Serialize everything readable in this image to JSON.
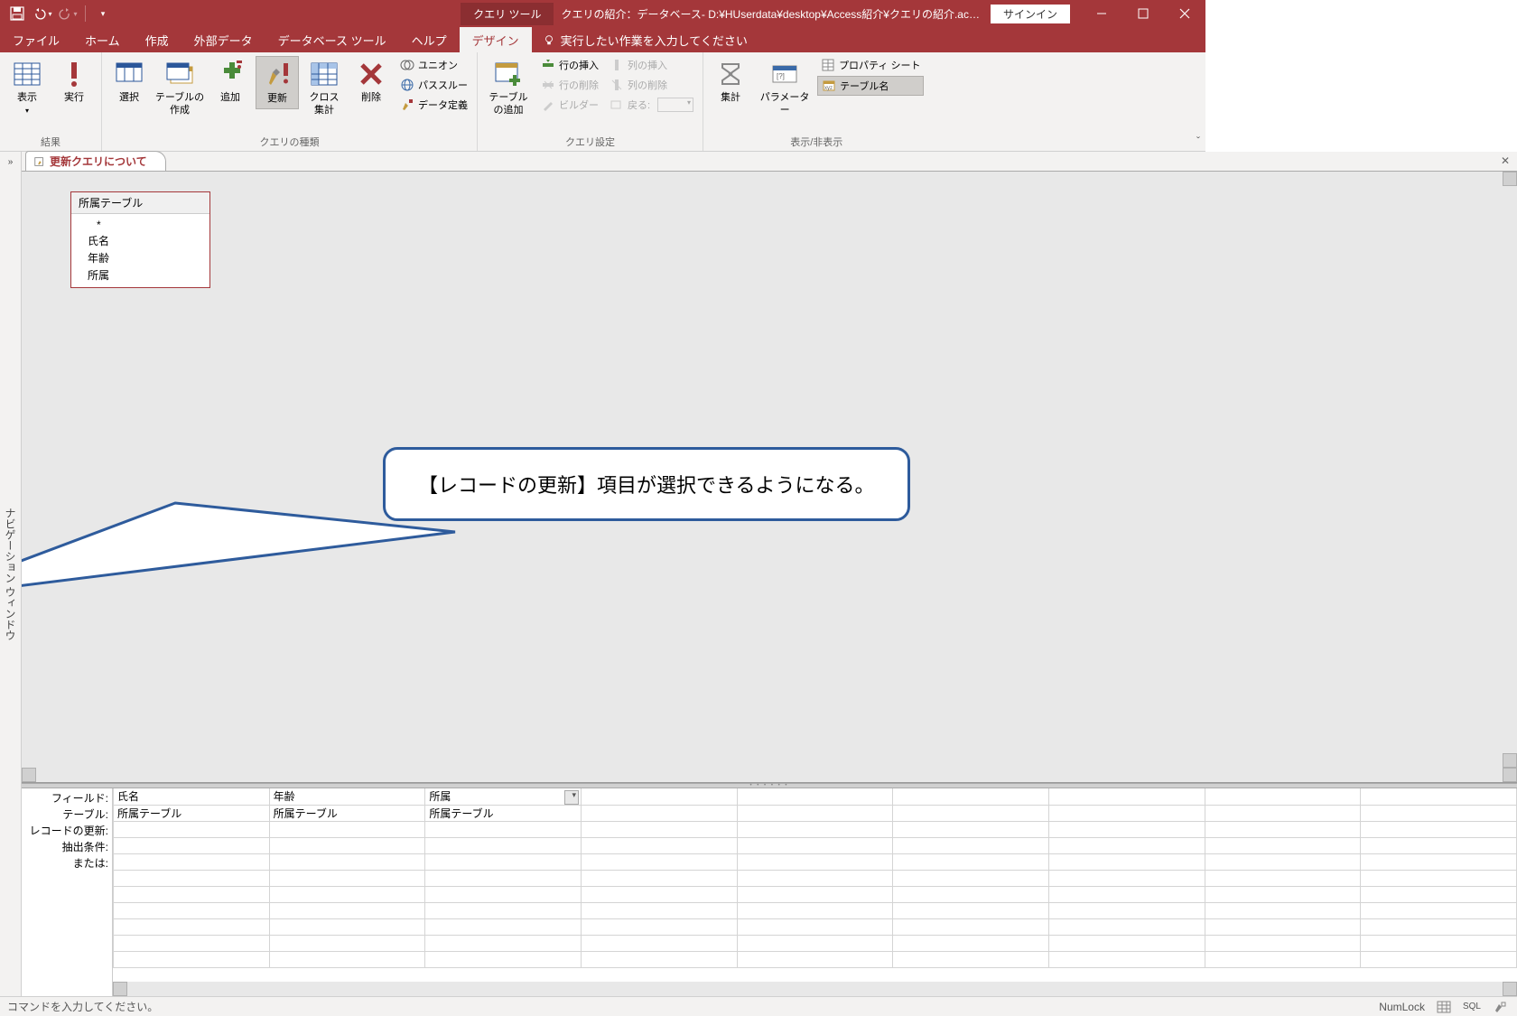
{
  "titlebar": {
    "tool_tab": "クエリ ツール",
    "title": "クエリの紹介：データベース- D:¥HUserdata¥desktop¥Access紹介¥クエリの紹介.ac…",
    "signin": "サインイン"
  },
  "menu": {
    "tabs": [
      "ファイル",
      "ホーム",
      "作成",
      "外部データ",
      "データベース ツール",
      "ヘルプ",
      "デザイン"
    ],
    "active_index": 6,
    "tell_me": "実行したい作業を入力してください"
  },
  "ribbon": {
    "groups": {
      "results": {
        "label": "結果",
        "view": "表示",
        "run": "実行"
      },
      "query_type": {
        "label": "クエリの種類",
        "select": "選択",
        "make_table": "テーブルの\n作成",
        "append": "追加",
        "update": "更新",
        "crosstab": "クロス\n集計",
        "delete": "削除",
        "union": "ユニオン",
        "passthrough": "パススルー",
        "datadef": "データ定義"
      },
      "query_setup": {
        "label": "クエリ設定",
        "add_table": "テーブル\nの追加",
        "insert_row": "行の挿入",
        "delete_row": "行の削除",
        "builder": "ビルダー",
        "insert_col": "列の挿入",
        "delete_col": "列の削除",
        "return": "戻る:"
      },
      "show_hide": {
        "label": "表示/非表示",
        "totals": "集計",
        "parameters": "パラメーター",
        "property": "プロパティ シート",
        "table_names": "テーブル名"
      }
    }
  },
  "query": {
    "tab_name": "更新クエリについて",
    "table": {
      "name": "所属テーブル",
      "star": "*",
      "fields": [
        "氏名",
        "年齢",
        "所属"
      ]
    },
    "row_labels": [
      "フィールド:",
      "テーブル:",
      "レコードの更新:",
      "抽出条件:",
      "または:"
    ],
    "cols": [
      {
        "field": "氏名",
        "table": "所属テーブル"
      },
      {
        "field": "年齢",
        "table": "所属テーブル"
      },
      {
        "field": "所属",
        "table": "所属テーブル",
        "dropdown": true
      }
    ]
  },
  "callout": {
    "text": "【レコードの更新】項目が選択できるようになる。"
  },
  "statusbar": {
    "left": "コマンドを入力してください。",
    "numlock": "NumLock",
    "sql": "SQL"
  },
  "navpane": {
    "label": "ナビゲーション ウィンドウ"
  }
}
